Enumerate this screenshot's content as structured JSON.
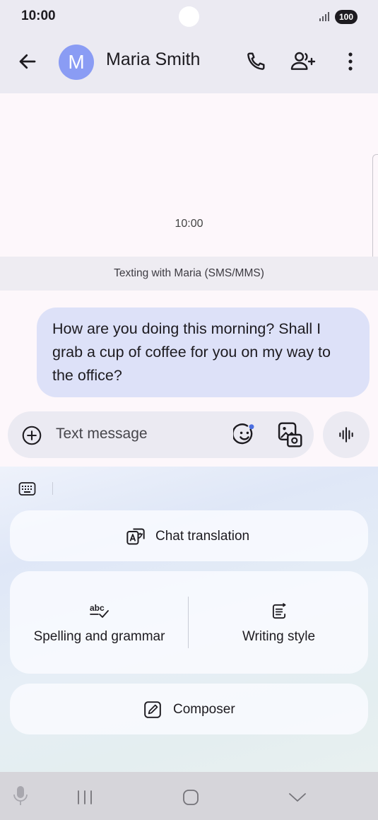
{
  "status_bar": {
    "time": "10:00",
    "battery": "100"
  },
  "header": {
    "avatar_letter": "M",
    "contact_name": "Maria Smith"
  },
  "conversation": {
    "timestamp": "10:00",
    "texting_banner": "Texting with Maria (SMS/MMS)",
    "messages": [
      {
        "text": "How are you doing this morning? Shall I grab a cup of coffee for you on my way to the office?",
        "sender": "me"
      }
    ]
  },
  "compose": {
    "placeholder": "Text message"
  },
  "ai_panel": {
    "chat_translation": "Chat translation",
    "spelling_grammar": "Spelling and grammar",
    "writing_style": "Writing style",
    "composer": "Composer"
  },
  "colors": {
    "accent": "#8a9cf4",
    "bubble": "#dde1f8",
    "app_bar": "#ebeaf2"
  }
}
